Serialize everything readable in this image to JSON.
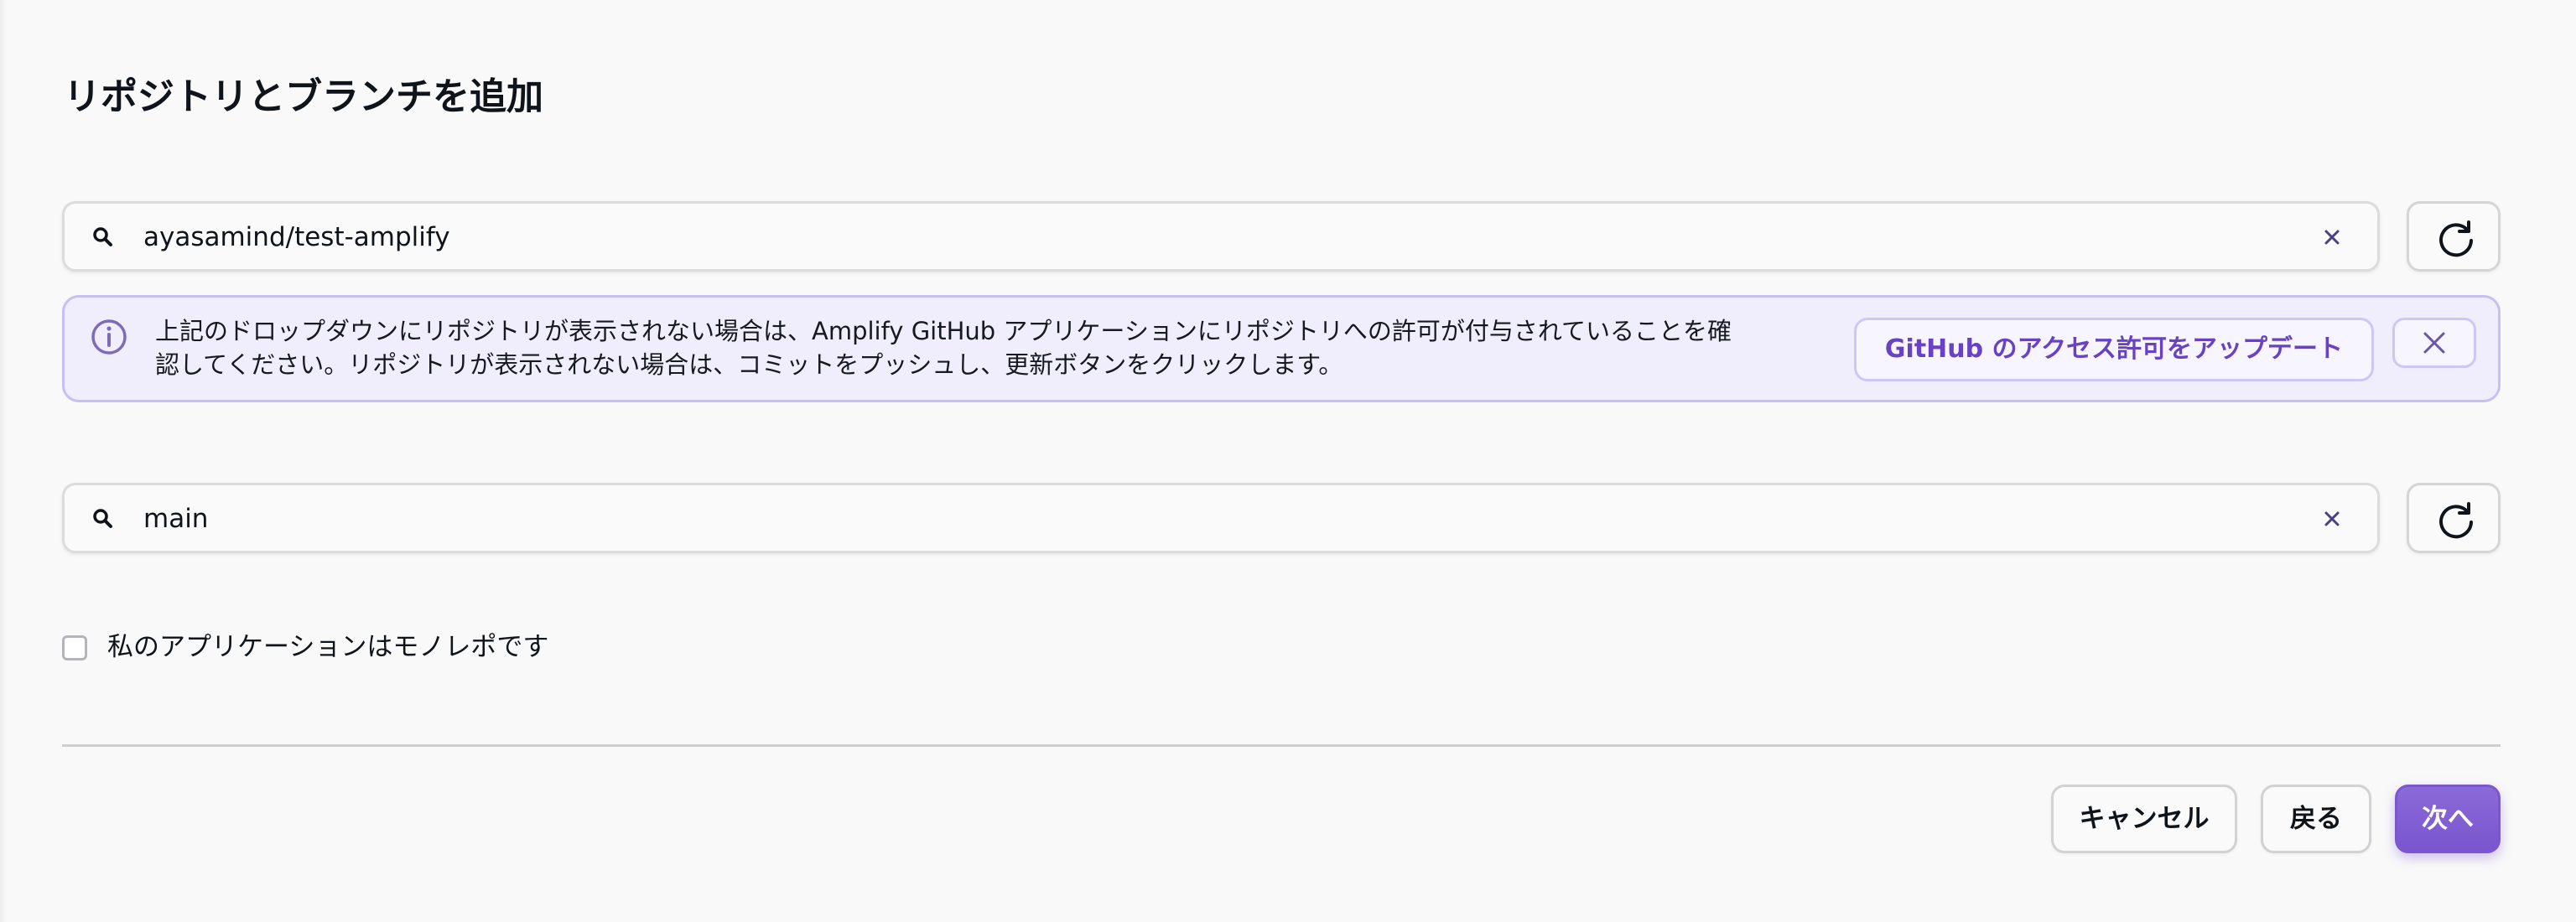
{
  "page": {
    "title": "リポジトリとブランチを追加"
  },
  "repository_search": {
    "value": "ayasamind/test-amplify",
    "icons": [
      "search-icon",
      "clear-icon",
      "refresh-icon"
    ]
  },
  "alert": {
    "line1": "上記のドロップダウンにリポジトリが表示されない場合は、Amplify GitHub アプリケーションにリポジトリへの許可が付与されていることを確",
    "line2": "認してください。リポジトリが表示されない場合は、コミットをプッシュし、更新ボタンをクリックします。",
    "action_label": "GitHub のアクセス許可をアップデート",
    "icons": [
      "info-icon",
      "close-icon"
    ]
  },
  "branch_search": {
    "value": "main"
  },
  "monorepo_checkbox": {
    "label": "私のアプリケーションはモノレポです",
    "checked": false
  },
  "footer": {
    "cancel_label": "キャンセル",
    "back_label": "戻る",
    "next_label": "次へ"
  },
  "colors": {
    "accent": "#7a55cf",
    "alert_background": "#f0eefc",
    "alert_border": "#c9bff3",
    "page_background": "#f9f9f9"
  }
}
